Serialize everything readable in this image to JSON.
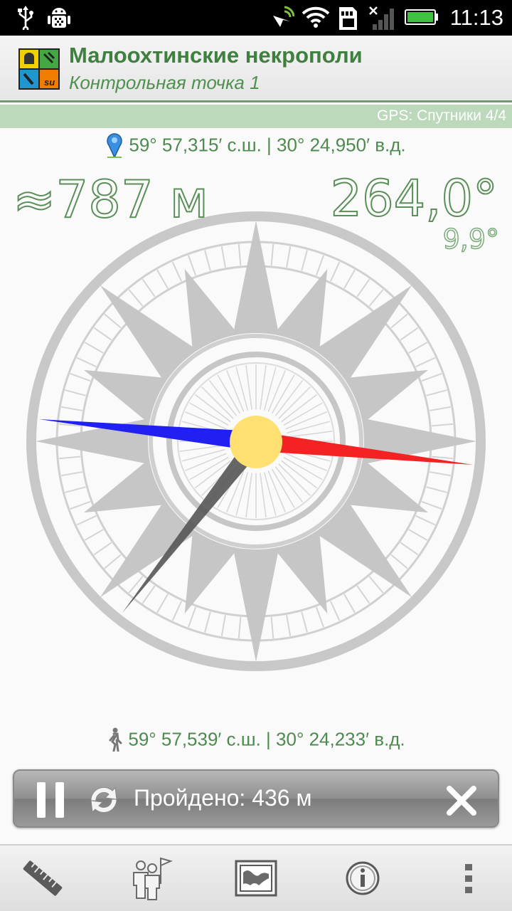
{
  "status_bar": {
    "time": "11:13",
    "icons": [
      "usb-icon",
      "debug-icon",
      "gps-active-icon",
      "wifi-icon",
      "sd-card-icon",
      "signal-icon",
      "battery-icon"
    ]
  },
  "header": {
    "title": "Малоохтинские некрополи",
    "subtitle": "Контрольная точка 1",
    "logo": "geocaching-su-logo"
  },
  "gps": {
    "status": "GPS: Спутники 4/4"
  },
  "target": {
    "coords": "59° 57,315′ с.ш. | 30° 24,950′ в.д.",
    "icon": "map-pin-icon"
  },
  "navigation": {
    "distance": "≈787 м",
    "bearing": "264,0°",
    "accuracy": "9,9°"
  },
  "compass": {
    "north_needle_color": "#f42323",
    "south_needle_color": "#2020f2",
    "target_needle_color": "#555555",
    "hub_color": "#ffe070"
  },
  "current": {
    "coords": "59° 57,539′ с.ш. | 30° 24,233′ в.д.",
    "icon": "walker-icon"
  },
  "trip": {
    "label": "Пройдено: 436 м"
  },
  "toolbar": {
    "items": [
      "ruler-icon",
      "people-flag-icon",
      "map-icon",
      "info-icon",
      "more-icon"
    ]
  }
}
